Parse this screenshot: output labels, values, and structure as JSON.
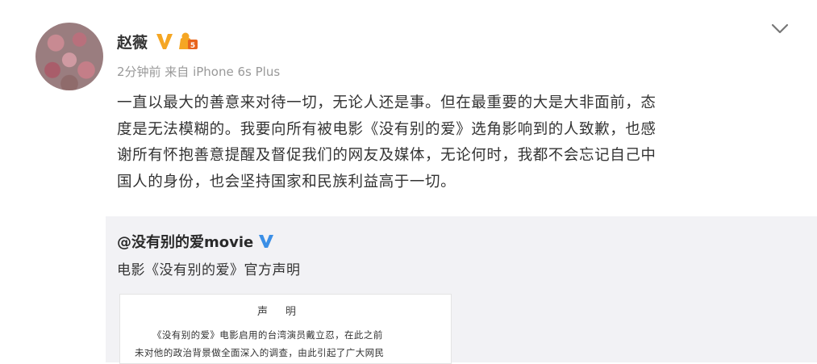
{
  "post": {
    "author": "赵薇",
    "meta": "2分钟前 来自 iPhone 6s Plus",
    "lines": [
      "一直以最大的善意来对待一切，无论人还是事。但在最重要的大是大非面前，态",
      "度是无法模糊的。我要向所有被电影《没有别的爱》选角影响到的人致歉，也感",
      "谢所有怀抱善意提醒及督促我们的网友及媒体，无论何时，我都不会忘记自己中",
      "国人的身份，也会坚持国家和民族利益高于一切。"
    ]
  },
  "repost": {
    "author": "@没有别的爱movie",
    "text": "电影《没有别的爱》官方声明",
    "statement": {
      "title": "声明",
      "line1": "《没有别的爱》电影启用的台湾演员戴立忍，在此之前",
      "line2": "未对他的政治背景做全面深入的调查，由此引起了广大网民"
    }
  },
  "colors": {
    "verified_gold": "#f5a623",
    "verified_blue": "#3b8fe6",
    "meta_gray": "#999999",
    "repost_bg": "#f2f2f5"
  },
  "icons": [
    "verified-v-icon",
    "vip-badge-icon",
    "chevron-down-icon",
    "verified-blue-icon"
  ]
}
